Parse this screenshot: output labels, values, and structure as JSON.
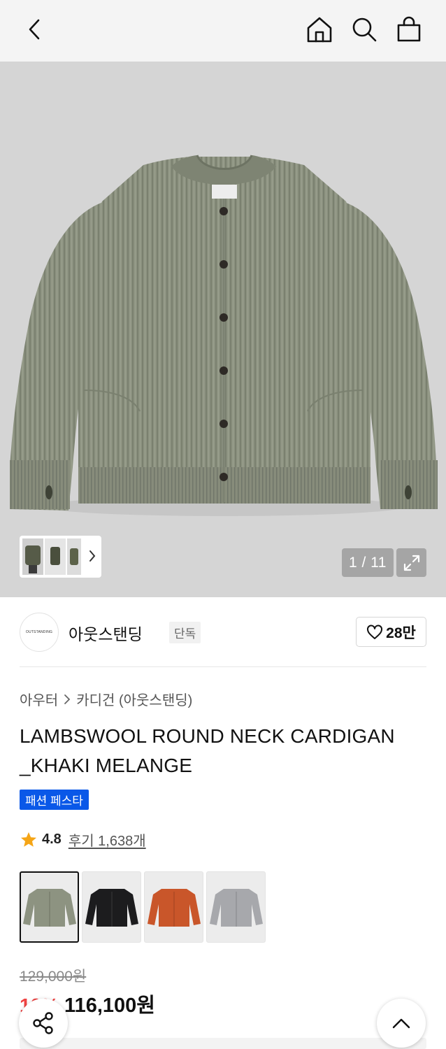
{
  "header": {
    "back_icon": "chevron-left-icon",
    "home_icon": "home-icon",
    "search_icon": "search-icon",
    "bag_icon": "shopping-bag-icon"
  },
  "gallery": {
    "counter": "1 / 11",
    "expand_icon": "expand-icon",
    "thumb_arrow_icon": "chevron-right-icon"
  },
  "brand": {
    "logo_text": "OUTSTANDING",
    "name": "아웃스탠딩",
    "tag": "단독",
    "like_icon": "heart-icon",
    "like_count": "28만"
  },
  "product": {
    "breadcrumb": [
      "아우터",
      "카디건 (아웃스탠딩)"
    ],
    "breadcrumb_sep_icon": "chevron-right-icon",
    "title": "LAMBSWOOL ROUND NECK CARDIGAN _KHAKI MELANGE",
    "badge": "패션 페스타",
    "rating_icon": "star-icon",
    "rating": "4.8",
    "review_link": "후기 1,638개"
  },
  "colors": [
    {
      "name": "khaki",
      "hex": "#8d9381",
      "selected": true
    },
    {
      "name": "black",
      "hex": "#1c1c1e",
      "selected": false
    },
    {
      "name": "orange",
      "hex": "#c9562a",
      "selected": false
    },
    {
      "name": "grey",
      "hex": "#a7a8ac",
      "selected": false
    }
  ],
  "price": {
    "original": "129,000원",
    "discount": "10%",
    "sale": "116,100원"
  },
  "fab": {
    "share_icon": "share-icon",
    "top_icon": "chevron-up-icon"
  },
  "theme": {
    "accent_blue": "#0a58e8",
    "discount_red": "#f04343",
    "garment_khaki": "#8d9381"
  }
}
